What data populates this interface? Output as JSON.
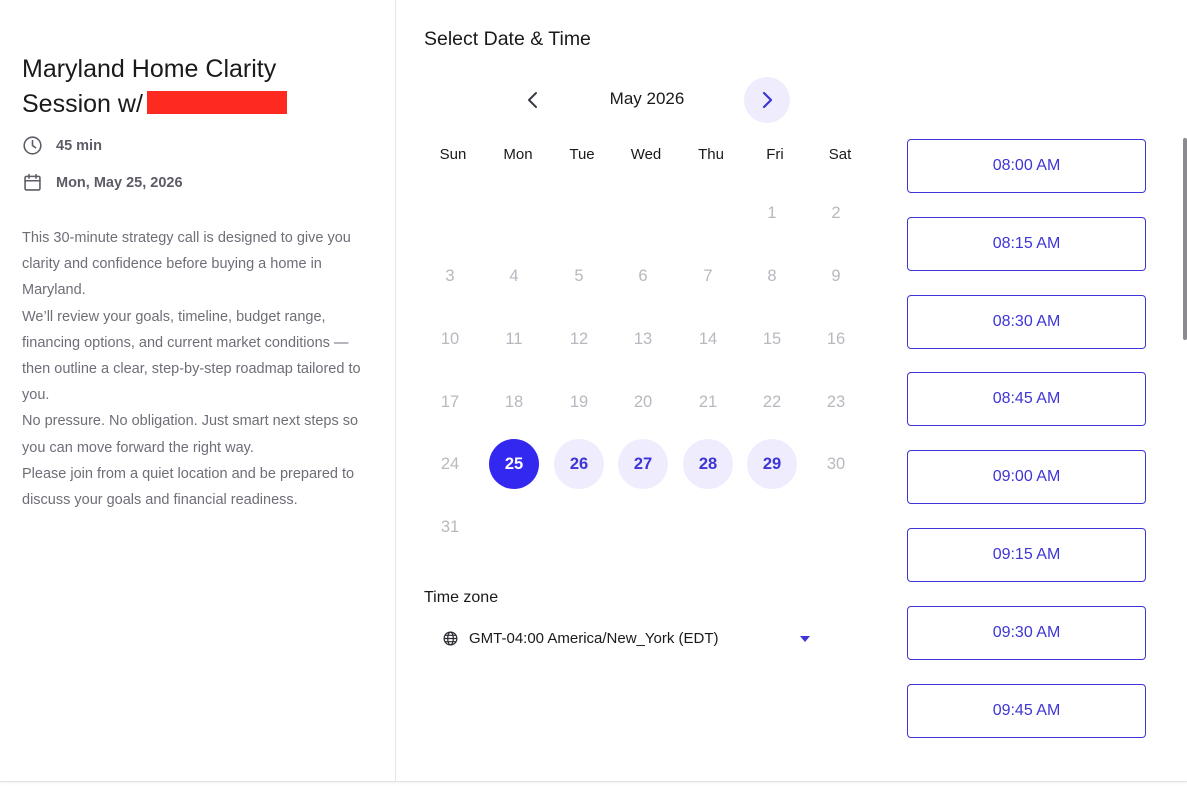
{
  "event": {
    "title": "Maryland Home Clarity Session w/",
    "duration": "45 min",
    "date": "Mon, May 25, 2026",
    "description": [
      "This 30-minute strategy call is designed to give you clarity and confidence before buying a home in Maryland.",
      "We’ll review your goals, timeline, budget range, financing options, and current market conditions — then outline a clear, step-by-step roadmap tailored to you.",
      "No pressure. No obligation. Just smart next steps so you can move forward the right way.",
      "Please join from a quiet location and be prepared to discuss your goals and financial readiness."
    ]
  },
  "picker": {
    "heading": "Select Date & Time",
    "month_label": "May 2026",
    "weekdays": [
      "Sun",
      "Mon",
      "Tue",
      "Wed",
      "Thu",
      "Fri",
      "Sat"
    ],
    "weeks": [
      [
        null,
        null,
        null,
        null,
        null,
        "1",
        "2"
      ],
      [
        "3",
        "4",
        "5",
        "6",
        "7",
        "8",
        "9"
      ],
      [
        "10",
        "11",
        "12",
        "13",
        "14",
        "15",
        "16"
      ],
      [
        "17",
        "18",
        "19",
        "20",
        "21",
        "22",
        "23"
      ],
      [
        "24",
        "25",
        "26",
        "27",
        "28",
        "29",
        "30"
      ],
      [
        "31",
        null,
        null,
        null,
        null,
        null,
        null
      ]
    ],
    "selected_day": "25",
    "available_days": [
      "26",
      "27",
      "28",
      "29"
    ]
  },
  "timezone": {
    "label": "Time zone",
    "value": "GMT-04:00 America/New_York (EDT)"
  },
  "slots": [
    "08:00 AM",
    "08:15 AM",
    "08:30 AM",
    "08:45 AM",
    "09:00 AM",
    "09:15 AM",
    "09:30 AM",
    "09:45 AM"
  ],
  "colors": {
    "accent": "#3d35d6",
    "selected": "#3328f0",
    "available_bg": "#efedfd",
    "redaction": "#ff2a1f"
  },
  "icons": {
    "duration": "clock-icon",
    "date": "calendar-icon",
    "prev": "chevron-left-icon",
    "next": "chevron-right-icon",
    "timezone": "globe-icon",
    "dropdown": "caret-down-icon"
  }
}
